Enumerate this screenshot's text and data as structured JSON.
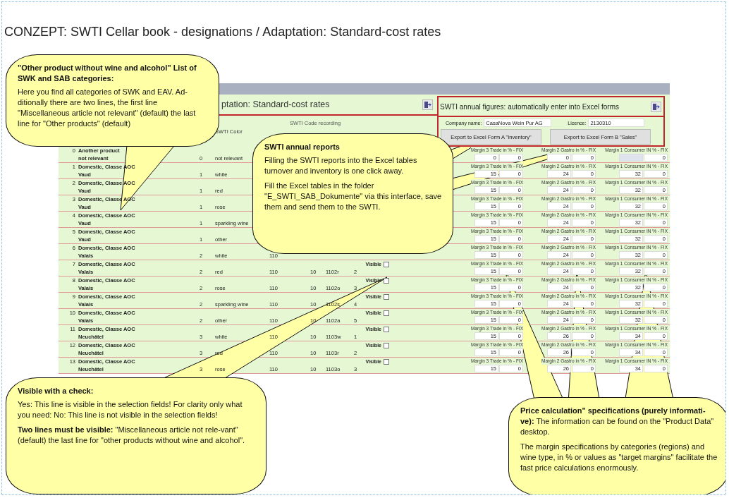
{
  "page_title": "CONZEPT: SWTI Cellar book - designations / Adaptation: Standard-cost rates",
  "app": {
    "title": "ptation: Standard-cost rates",
    "column_headers": {
      "wine_color": "SWTI Color",
      "code_recording": "SWTI Code recording"
    },
    "export_panel": {
      "title": "SWTI annual figures: automatically enter into Excel forms",
      "company_label": "Company name:",
      "company": "CasaNova Wein Pur AG",
      "licence_label": "Licence:",
      "licence": "2130310",
      "buttons": [
        "Export to Excel Form A \"Inventory\"",
        "Export to Excel Form B \"Sales\""
      ]
    },
    "rows": [
      {
        "no": "0",
        "category": "Another product",
        "origin": "not relevant",
        "type": "0",
        "wine_color": "not relevant",
        "margins": [
          {
            "label": "Margin 3 Trade in % - FIX",
            "fields": [
              {
                "value": "0"
              },
              {
                "value": "0"
              }
            ]
          },
          {
            "label": "Margin 2 Gastro in % - FIX",
            "fields": [
              {
                "value": "0"
              },
              {
                "value": "0"
              }
            ]
          },
          {
            "label": "Margin 1 Consumer IN % - FIX",
            "fields": [
              {
                "focused": true
              },
              {
                "value": "0"
              }
            ]
          }
        ]
      },
      {
        "no": "1",
        "category": "Domestic, Classe AOC",
        "origin": "Vaud",
        "type": "1",
        "wine_color": "white",
        "margins": [
          {
            "label": "Margin 3 Trade in % - FIX",
            "fields": [
              {
                "value": "15"
              },
              {
                "value": "0"
              }
            ]
          },
          {
            "label": "Margin 2 Gastro in % - FIX",
            "fields": [
              {
                "value": "24"
              },
              {
                "value": "0"
              }
            ]
          },
          {
            "label": "Margin 1 Consumer IN % - FIX",
            "fields": [
              {
                "value": "32"
              },
              {
                "value": "0"
              }
            ]
          }
        ]
      },
      {
        "no": "2",
        "category": "Domestic, Classe AOC",
        "origin": "Vaud",
        "type": "1",
        "wine_color": "red",
        "margins": [
          {
            "label": "Margin 3 Trade in % - FIX",
            "fields": [
              {
                "value": "15"
              },
              {
                "value": "0"
              }
            ]
          },
          {
            "label": "Margin 2 Gastro in % - FIX",
            "fields": [
              {
                "value": "24"
              },
              {
                "value": "0"
              }
            ]
          },
          {
            "label": "Margin 1 Consumer IN % - FIX",
            "fields": [
              {
                "value": "32"
              },
              {
                "value": "0"
              }
            ]
          }
        ]
      },
      {
        "no": "3",
        "category": "Domestic, Classe AOC",
        "origin": "Vaud",
        "type": "1",
        "wine_color": "rose",
        "margins": [
          {
            "label": "Margin 3 Trade in % - FIX",
            "fields": [
              {
                "value": "15"
              },
              {
                "value": "0"
              }
            ]
          },
          {
            "label": "Margin 2 Gastro in % - FIX",
            "fields": [
              {
                "value": "24"
              },
              {
                "value": "0"
              }
            ]
          },
          {
            "label": "Margin 1 Consumer IN % - FIX",
            "fields": [
              {
                "value": "32"
              },
              {
                "value": "0"
              }
            ]
          }
        ]
      },
      {
        "no": "4",
        "category": "Domestic, Classe AOC",
        "origin": "Vaud",
        "type": "1",
        "wine_color": "sparkling wine",
        "margins": [
          {
            "label": "Margin 3 Trade in % - FIX",
            "fields": [
              {
                "value": "15"
              },
              {
                "value": "0"
              }
            ]
          },
          {
            "label": "Margin 2 Gastro in % - FIX",
            "fields": [
              {
                "value": "24"
              },
              {
                "value": "0"
              }
            ]
          },
          {
            "label": "Margin 1 Consumer IN % - FIX",
            "fields": [
              {
                "value": "32"
              },
              {
                "value": "0"
              }
            ]
          }
        ]
      },
      {
        "no": "5",
        "category": "Domestic, Classe AOC",
        "origin": "Vaud",
        "type": "1",
        "wine_color": "other",
        "margins": [
          {
            "label": "Margin 3 Trade in % - FIX",
            "fields": [
              {
                "value": "15"
              },
              {
                "value": "0"
              }
            ]
          },
          {
            "label": "Margin 2 Gastro in % - FIX",
            "fields": [
              {
                "value": "24"
              },
              {
                "value": "0"
              }
            ]
          },
          {
            "label": "Margin 1 Consumer IN % - FIX",
            "fields": [
              {
                "value": "32"
              },
              {
                "value": "0"
              }
            ]
          }
        ]
      },
      {
        "no": "6",
        "category": "Domestic, Classe AOC",
        "origin": "Valais",
        "type": "2",
        "wine_color": "white",
        "code_1": "110",
        "margins": [
          {
            "label": "Margin 3 Trade in % - FIX",
            "fields": [
              {
                "value": "15"
              },
              {
                "value": "0"
              }
            ]
          },
          {
            "label": "Margin 2 Gastro in % - FIX",
            "fields": [
              {
                "value": "24"
              },
              {
                "value": "0"
              }
            ]
          },
          {
            "label": "Margin 1 Consumer IN % - FIX",
            "fields": [
              {
                "value": "32"
              },
              {
                "value": "0"
              }
            ]
          }
        ]
      },
      {
        "no": "7",
        "category": "Domestic, Classe AOC",
        "origin": "Valais",
        "type": "2",
        "wine_color": "red",
        "code_1": "110",
        "code_2": "10",
        "code_3": "1102r",
        "typesort": "2",
        "visible_label": "Visible",
        "visible": false,
        "margins": [
          {
            "label": "Margin 3 Trade in % - FIX",
            "fields": [
              {
                "value": "15"
              },
              {
                "value": "0"
              }
            ]
          },
          {
            "label": "Margin 2 Gastro in % - FIX",
            "fields": [
              {
                "value": "24"
              },
              {
                "value": "0"
              }
            ]
          },
          {
            "label": "Margin 1 Consumer IN % - FIX",
            "fields": [
              {
                "value": "32"
              },
              {
                "value": "0"
              }
            ]
          }
        ]
      },
      {
        "no": "8",
        "category": "Domestic, Classe AOC",
        "origin": "Valais",
        "type": "2",
        "wine_color": "rose",
        "code_1": "110",
        "code_2": "10",
        "code_3": "1102o",
        "typesort": "3",
        "visible_label": "Visible",
        "visible": false,
        "margins": [
          {
            "label": "Margin 3 Trade in % - FIX",
            "fields": [
              {
                "value": "15"
              },
              {
                "value": "0"
              }
            ]
          },
          {
            "label": "Margin 2 Gastro in % - FIX",
            "fields": [
              {
                "value": "24"
              },
              {
                "value": "0"
              }
            ]
          },
          {
            "label": "Margin 1 Consumer IN % - FIX",
            "fields": [
              {
                "value": "32"
              },
              {
                "value": "0"
              }
            ]
          }
        ]
      },
      {
        "no": "9",
        "category": "Domestic, Classe AOC",
        "origin": "Valais",
        "type": "2",
        "wine_color": "sparkling wine",
        "code_1": "110",
        "code_2": "10",
        "code_3": "1102s",
        "typesort": "4",
        "visible_label": "Visible",
        "visible": false,
        "margins": [
          {
            "label": "Margin 3 Trade in % - FIX",
            "fields": [
              {
                "value": "15"
              },
              {
                "value": "0"
              }
            ]
          },
          {
            "label": "Margin 2 Gastro in % - FIX",
            "fields": [
              {
                "value": "24"
              },
              {
                "value": "0"
              }
            ]
          },
          {
            "label": "Margin 1 Consumer IN % - FIX",
            "fields": [
              {
                "value": "32"
              },
              {
                "value": "0"
              }
            ]
          }
        ]
      },
      {
        "no": "10",
        "category": "Domestic, Classe AOC",
        "origin": "Valais",
        "type": "2",
        "wine_color": "other",
        "code_1": "110",
        "code_2": "10",
        "code_3": "1102a",
        "typesort": "5",
        "visible_label": "Visible",
        "visible": false,
        "margins": [
          {
            "label": "Margin 3 Trade in % - FIX",
            "fields": [
              {
                "value": "15"
              },
              {
                "value": "0"
              }
            ]
          },
          {
            "label": "Margin 2 Gastro in % - FIX",
            "fields": [
              {
                "value": "24"
              },
              {
                "value": "0"
              }
            ]
          },
          {
            "label": "Margin 1 Consumer IN % - FIX",
            "fields": [
              {
                "value": "32"
              },
              {
                "value": "0"
              }
            ]
          }
        ]
      },
      {
        "no": "11",
        "category": "Domestic, Classe AOC",
        "origin": "Neuchâtel",
        "type": "3",
        "wine_color": "white",
        "code_1": "110",
        "code_2": "10",
        "code_3": "1103w",
        "typesort": "1",
        "visible_label": "Visible",
        "visible": false,
        "margins": [
          {
            "label": "Margin 3 Trade in % - FIX",
            "fields": [
              {
                "value": "15"
              },
              {
                "value": "0"
              }
            ]
          },
          {
            "label": "Margin 2 Gastro in % - FIX",
            "fields": [
              {
                "value": "26"
              },
              {
                "value": "0"
              }
            ]
          },
          {
            "label": "Margin 1 Consumer IN % - FIX",
            "fields": [
              {
                "value": "34"
              },
              {
                "value": "0"
              }
            ]
          }
        ]
      },
      {
        "no": "12",
        "category": "Domestic, Classe AOC",
        "origin": "Neuchâtel",
        "type": "3",
        "wine_color": "red",
        "code_1": "110",
        "code_2": "10",
        "code_3": "1103r",
        "typesort": "2",
        "visible_label": "Visible",
        "visible": false,
        "margins": [
          {
            "label": "Margin 3 Trade in % - FIX",
            "fields": [
              {
                "value": "15"
              },
              {
                "value": "0"
              }
            ]
          },
          {
            "label": "Margin 2 Gastro in % - FIX",
            "fields": [
              {
                "value": "26"
              },
              {
                "value": "0"
              }
            ]
          },
          {
            "label": "Margin 1 Consumer IN % - FIX",
            "fields": [
              {
                "value": "34"
              },
              {
                "value": "0"
              }
            ]
          }
        ]
      },
      {
        "no": "13",
        "category": "Domestic, Classe AOC",
        "origin": "Neuchâtel",
        "type": "3",
        "wine_color": "rose",
        "code_1": "110",
        "code_2": "10",
        "code_3": "1103o",
        "typesort": "3",
        "visible_label": "Visible",
        "visible": false,
        "margins": [
          {
            "label": "Margin 3 Trade in % - FIX",
            "fields": [
              {
                "value": "15"
              },
              {
                "value": "0"
              }
            ]
          },
          {
            "label": "Margin 2 Gastro in % - FIX",
            "fields": [
              {
                "value": "26"
              },
              {
                "value": "0"
              }
            ]
          },
          {
            "label": "Margin 1 Consumer IN % - FIX",
            "fields": [
              {
                "value": "34"
              },
              {
                "value": "0"
              }
            ]
          }
        ]
      }
    ]
  },
  "callouts": [
    {
      "heading": "\"Other product without wine and alcohol\" List of SWK and SAB categories:",
      "paragraphs": [
        "Here you find all categories of SWK and EAV. Ad-ditionally there are two lines, the first line \"Miscellaneous article not relevant\" (default) the last line for \"Other products\" (default)"
      ]
    },
    {
      "heading": "SWTI annual reports",
      "paragraphs": [
        "Filling the SWTI reports into the Excel tables turnover and inventory is one click away.",
        "Fill the Excel tables in the folder \"E_SWTI_SAB_Dokumente\" via this interface, save them and send them to the SWTI."
      ]
    },
    {
      "heading": "Visible with a check:",
      "paragraphs": [
        "Yes: This line is visible in the selection fields! For clarity only what you need: No: This line is not visible in the selection fields!",
        "**Two lines must be visible:** \"Miscellaneous article not rele-vant\" (default) the last line for \"other products without wine and alcohol\"."
      ]
    },
    {
      "paragraphs": [
        "**Price calculation\" specifications (purely informati-ve):** The information can be found on the \"Product Data\" desktop.",
        "The margin specifications by categories (regions) and wine type, in % or values as \"target margins\" facilitate the fast price calculations enormously."
      ]
    }
  ]
}
